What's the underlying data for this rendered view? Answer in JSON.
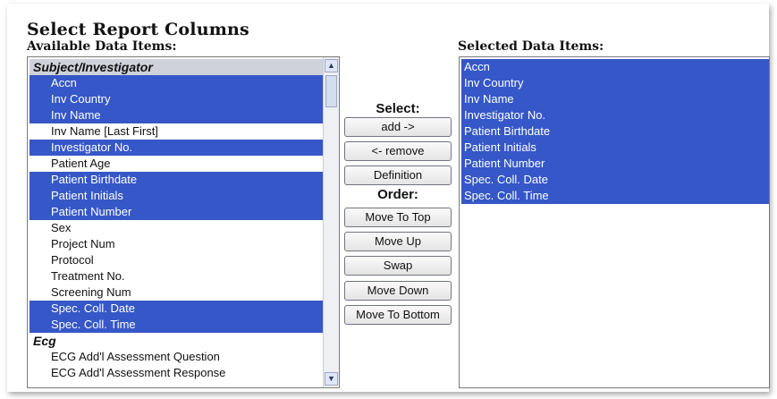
{
  "title": "Select Report Columns",
  "available_label": "Available Data Items:",
  "selected_label": "Selected Data Items:",
  "middle": {
    "select_label": "Select:",
    "order_label": "Order:",
    "add": "add ->",
    "remove": "<- remove",
    "definition": "Definition",
    "move_top": "Move To Top",
    "move_up": "Move Up",
    "swap": "Swap",
    "move_down": "Move Down",
    "move_bottom": "Move To Bottom"
  },
  "available_items": [
    {
      "text": "Subject/Investigator",
      "group": true,
      "selected": false
    },
    {
      "text": "Accn",
      "group": false,
      "selected": true
    },
    {
      "text": "Inv Country",
      "group": false,
      "selected": true
    },
    {
      "text": "Inv Name",
      "group": false,
      "selected": true
    },
    {
      "text": "Inv Name [Last First]",
      "group": false,
      "selected": false
    },
    {
      "text": "Investigator No.",
      "group": false,
      "selected": true
    },
    {
      "text": "Patient Age",
      "group": false,
      "selected": false
    },
    {
      "text": "Patient Birthdate",
      "group": false,
      "selected": true
    },
    {
      "text": "Patient Initials",
      "group": false,
      "selected": true
    },
    {
      "text": "Patient Number",
      "group": false,
      "selected": true
    },
    {
      "text": "Sex",
      "group": false,
      "selected": false
    },
    {
      "text": "Project Num",
      "group": false,
      "selected": false
    },
    {
      "text": "Protocol",
      "group": false,
      "selected": false
    },
    {
      "text": "Treatment No.",
      "group": false,
      "selected": false
    },
    {
      "text": "Screening Num",
      "group": false,
      "selected": false
    },
    {
      "text": "Spec. Coll. Date",
      "group": false,
      "selected": true
    },
    {
      "text": "Spec. Coll. Time",
      "group": false,
      "selected": true
    },
    {
      "text": "Ecg",
      "group": true,
      "selected": false
    },
    {
      "text": "ECG Add'l Assessment Question",
      "group": false,
      "selected": false
    },
    {
      "text": "ECG Add'l Assessment Response",
      "group": false,
      "selected": false
    }
  ],
  "selected_items": [
    "Accn",
    "Inv Country",
    "Inv Name",
    "Investigator No.",
    "Patient Birthdate",
    "Patient Initials",
    "Patient Number",
    "Spec. Coll. Date",
    "Spec. Coll. Time"
  ],
  "colors": {
    "selection": "#3557c7",
    "group_header_bg": "#cfd2da"
  },
  "icons": {
    "scroll_up": "chevron-up-icon",
    "scroll_down": "chevron-down-icon"
  }
}
